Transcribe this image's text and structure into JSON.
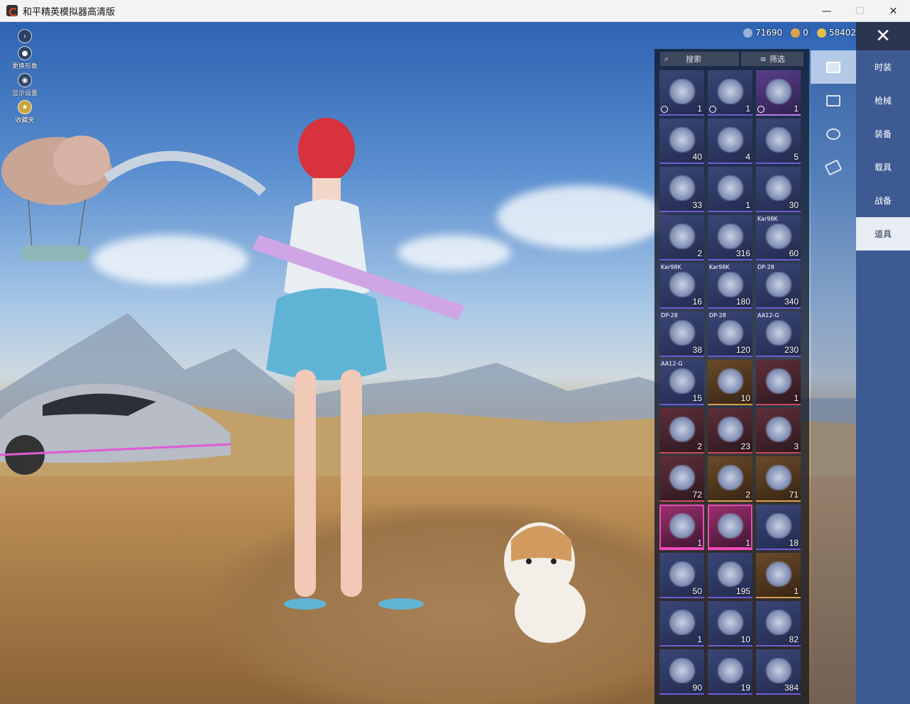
{
  "window": {
    "title": "和平精英模拟器高清版",
    "controls": {
      "minimize": "—",
      "maximize": "☐",
      "close": "✕"
    }
  },
  "left_tools": [
    {
      "name": "expand",
      "label": ""
    },
    {
      "name": "change-look",
      "label": "更换形象"
    },
    {
      "name": "display-settings",
      "label": "显示设置"
    },
    {
      "name": "collect",
      "label": "收藏夹"
    }
  ],
  "currency": [
    {
      "name": "silver",
      "value": "71690",
      "color": "#9ab3d6"
    },
    {
      "name": "gold-medal",
      "value": "0",
      "color": "#d8a24b"
    },
    {
      "name": "coin",
      "value": "58402",
      "color": "#e3c04a"
    }
  ],
  "close_label": "✕",
  "categories": [
    {
      "label": "时装",
      "active": false
    },
    {
      "label": "枪械",
      "active": false
    },
    {
      "label": "装备",
      "active": false
    },
    {
      "label": "载具",
      "active": false
    },
    {
      "label": "战备",
      "active": false
    },
    {
      "label": "道具",
      "active": true
    }
  ],
  "subtabs": [
    {
      "name": "card",
      "active": true
    },
    {
      "name": "calendar",
      "active": false
    },
    {
      "name": "sparkle",
      "active": false
    },
    {
      "name": "ticket",
      "active": false
    }
  ],
  "search": {
    "placeholder": "搜索",
    "filter_label": "筛选"
  },
  "items": [
    {
      "qty": "1",
      "tag": "",
      "style": "",
      "clock": true,
      "icon": "ticket-icon"
    },
    {
      "qty": "1",
      "tag": "",
      "style": "",
      "clock": true,
      "icon": "ticket-icon"
    },
    {
      "qty": "1",
      "tag": "",
      "style": "purple",
      "clock": true,
      "icon": "ticket-icon"
    },
    {
      "qty": "40",
      "tag": "",
      "style": "",
      "clock": false,
      "icon": "spray-can-icon"
    },
    {
      "qty": "4",
      "tag": "",
      "style": "",
      "clock": false,
      "icon": "crate-icon"
    },
    {
      "qty": "5",
      "tag": "",
      "style": "",
      "clock": false,
      "icon": "spring-icon"
    },
    {
      "qty": "33",
      "tag": "",
      "style": "",
      "clock": false,
      "icon": "disc-icon"
    },
    {
      "qty": "1",
      "tag": "",
      "style": "",
      "clock": false,
      "icon": "key-icon"
    },
    {
      "qty": "30",
      "tag": "",
      "style": "",
      "clock": false,
      "icon": "paint-can-icon"
    },
    {
      "qty": "2",
      "tag": "",
      "style": "",
      "clock": false,
      "icon": "magazine-icon"
    },
    {
      "qty": "316",
      "tag": "",
      "style": "",
      "clock": false,
      "icon": "spring-icon"
    },
    {
      "qty": "60",
      "tag": "Kar98K",
      "style": "",
      "clock": false,
      "icon": "paint-can-icon"
    },
    {
      "qty": "16",
      "tag": "Kar98K",
      "style": "",
      "clock": false,
      "icon": "magazine-icon"
    },
    {
      "qty": "180",
      "tag": "Kar98K",
      "style": "",
      "clock": false,
      "icon": "spring-icon"
    },
    {
      "qty": "340",
      "tag": "DP-28",
      "style": "",
      "clock": false,
      "icon": "paint-can-icon"
    },
    {
      "qty": "38",
      "tag": "DP-28",
      "style": "",
      "clock": false,
      "icon": "magazine-icon"
    },
    {
      "qty": "120",
      "tag": "DP-28",
      "style": "",
      "clock": false,
      "icon": "spring-icon"
    },
    {
      "qty": "230",
      "tag": "AA12-G",
      "style": "",
      "clock": false,
      "icon": "paint-can-icon"
    },
    {
      "qty": "15",
      "tag": "AA12-G",
      "style": "",
      "clock": false,
      "icon": "magazine-icon"
    },
    {
      "qty": "10",
      "tag": "",
      "style": "gold",
      "clock": false,
      "icon": "id-card-icon"
    },
    {
      "qty": "1",
      "tag": "",
      "style": "red",
      "clock": false,
      "icon": "ticket-icon"
    },
    {
      "qty": "2",
      "tag": "",
      "style": "red",
      "clock": false,
      "icon": "ticket-icon"
    },
    {
      "qty": "23",
      "tag": "",
      "style": "red",
      "clock": false,
      "icon": "ticket-icon"
    },
    {
      "qty": "3",
      "tag": "",
      "style": "red",
      "clock": false,
      "icon": "ticket-icon"
    },
    {
      "qty": "72",
      "tag": "",
      "style": "red",
      "clock": false,
      "icon": "ticket-icon"
    },
    {
      "qty": "2",
      "tag": "",
      "style": "gold",
      "clock": false,
      "icon": "ticket-icon"
    },
    {
      "qty": "71",
      "tag": "",
      "style": "gold",
      "clock": false,
      "icon": "ticket-icon"
    },
    {
      "qty": "1",
      "tag": "",
      "style": "pink",
      "clock": false,
      "icon": "lion-emblem-icon"
    },
    {
      "qty": "1",
      "tag": "",
      "style": "pink",
      "clock": false,
      "icon": "refresh-coin-icon"
    },
    {
      "qty": "18",
      "tag": "",
      "style": "",
      "clock": false,
      "icon": "stick-icon"
    },
    {
      "qty": "50",
      "tag": "",
      "style": "",
      "clock": false,
      "icon": "ticket-icon"
    },
    {
      "qty": "195",
      "tag": "",
      "style": "",
      "clock": false,
      "icon": "puzzle-orb-icon"
    },
    {
      "qty": "1",
      "tag": "",
      "style": "gold",
      "clock": false,
      "icon": "crest-icon"
    },
    {
      "qty": "1",
      "tag": "",
      "style": "",
      "clock": false,
      "icon": "dragon-badge-icon"
    },
    {
      "qty": "10",
      "tag": "",
      "style": "",
      "clock": false,
      "icon": "key-icon"
    },
    {
      "qty": "82",
      "tag": "",
      "style": "",
      "clock": false,
      "icon": "gem-frame-icon"
    },
    {
      "qty": "90",
      "tag": "",
      "style": "",
      "clock": false,
      "icon": "diamond-icon"
    },
    {
      "qty": "19",
      "tag": "",
      "style": "",
      "clock": false,
      "icon": "canister-icon"
    },
    {
      "qty": "384",
      "tag": "",
      "style": "",
      "clock": false,
      "icon": "spray-can-icon"
    }
  ]
}
